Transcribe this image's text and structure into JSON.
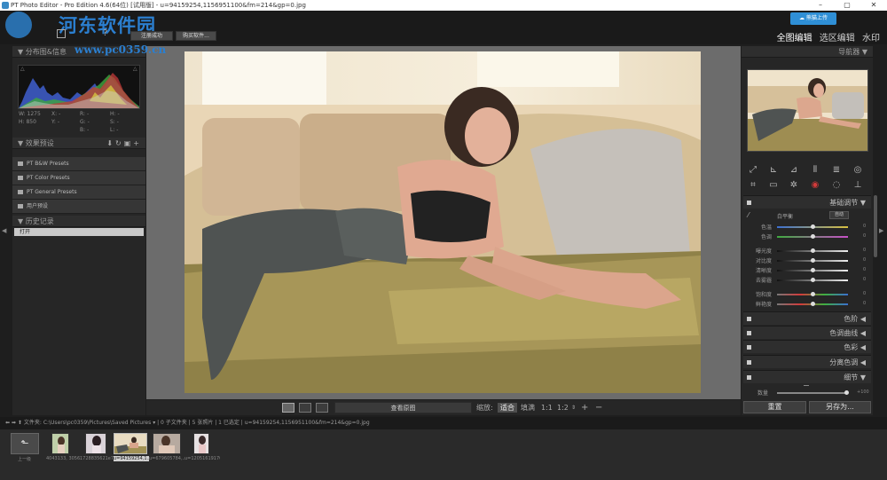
{
  "window": {
    "title": "PT Photo Editor - Pro Edition 4.6(64位) [试用版] - u=94159254,1156951100&fm=214&gp=0.jpg"
  },
  "watermark": {
    "title": "河东软件园",
    "url": "www.pc0359.cn"
  },
  "topbar": {
    "register_label": "注册成功",
    "buy_label": "购买软件...",
    "cloud_label": "熊猫上传"
  },
  "modes": {
    "full": "全图编辑",
    "selective": "选区编辑",
    "watermark": "水印"
  },
  "left": {
    "histogram_title": "分布图&信息",
    "readout": {
      "w_label": "W:",
      "w_value": "1275",
      "h_label": "H:",
      "h_value": "850",
      "x_label": "X:",
      "y_label": "Y:",
      "r_label": "R:",
      "g_label": "G:",
      "b_label": "B:",
      "hh_label": "H:",
      "s_label": "S:",
      "l_label": "L:",
      "dash": "-"
    },
    "presets_title": "效果预设",
    "presets": [
      {
        "label": "PT B&W Presets"
      },
      {
        "label": "PT Color Presets"
      },
      {
        "label": "PT General Presets"
      },
      {
        "label": "用户预设"
      }
    ],
    "history_title": "历史记录",
    "history": [
      {
        "label": "打开"
      }
    ]
  },
  "center": {
    "before_after_label": "查看原图",
    "zoom_label": "缩放:",
    "zoom_fit": "适合",
    "zoom_fill": "填满",
    "zoom_1_1": "1:1",
    "zoom_1_2": "1:2",
    "plus": "+",
    "minus": "−"
  },
  "right": {
    "navigator_title": "导航器",
    "basic_title": "基础调节",
    "white_balance_label": "白平衡",
    "auto_label": "自动",
    "sliders": [
      {
        "label": "色温",
        "value": "0"
      },
      {
        "label": "色调",
        "value": "0"
      },
      {
        "label": "曝光度",
        "value": "0"
      },
      {
        "label": "对比度",
        "value": "0"
      },
      {
        "label": "清晰度",
        "value": "0"
      },
      {
        "label": "去雾霾",
        "value": "0"
      },
      {
        "label": "饱和度",
        "value": "0"
      },
      {
        "label": "鲜艳度",
        "value": "0"
      }
    ],
    "sections": [
      {
        "label": "色阶"
      },
      {
        "label": "色调曲线"
      },
      {
        "label": "色彩"
      },
      {
        "label": "分离色调"
      },
      {
        "label": "细节"
      }
    ],
    "amount_label": "数量",
    "amount_value": "+100",
    "reset_label": "重置",
    "save_as_label": "另存为..."
  },
  "pathbar": {
    "folder_label": "文件夹:",
    "path": "C:\\Users\\pc0359\\Pictures\\Saved Pictures",
    "info": "| 0 子文件夹 | 5 张照片 | 1 已选定 | u=94159254,1156951100&fm=214&gp=0.jpg"
  },
  "filmstrip": {
    "up_label": "上一级",
    "items": [
      {
        "caption": "4043133, 3056..."
      },
      {
        "caption": "1728835621e7..."
      },
      {
        "caption": "u=94159254,1..."
      },
      {
        "caption": "u=679605784,..."
      },
      {
        "caption": "u=12051619170..."
      }
    ]
  }
}
